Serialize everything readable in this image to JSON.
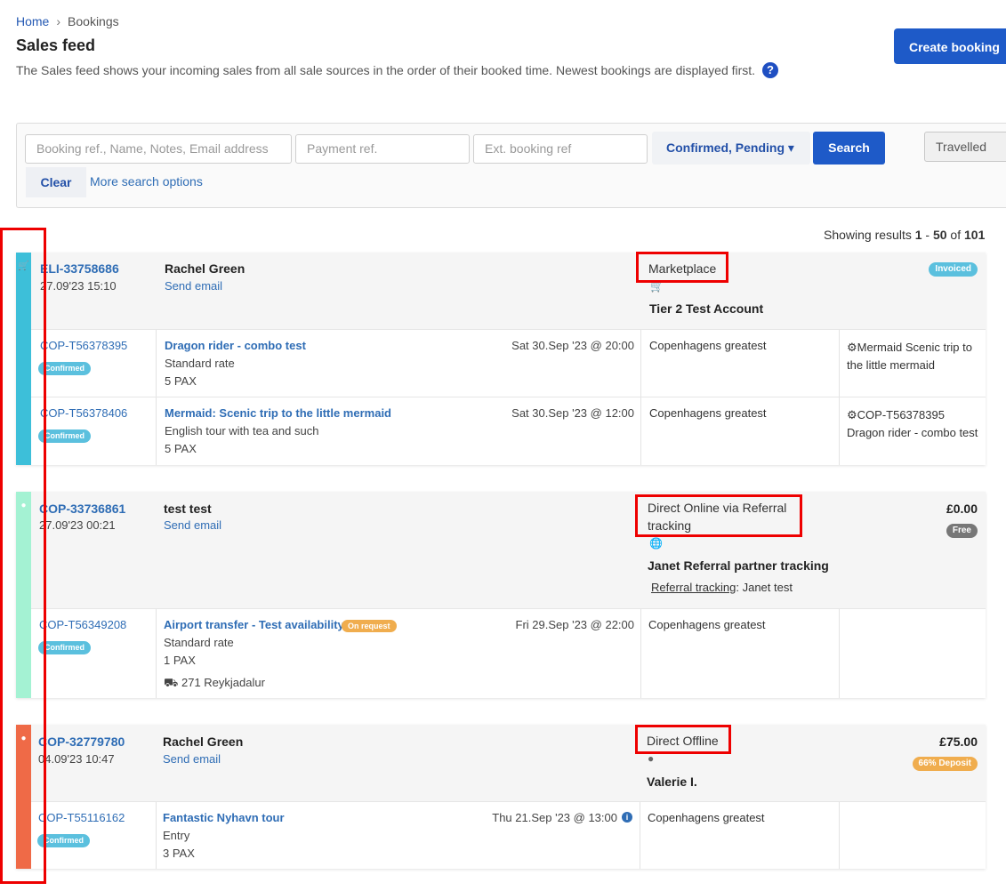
{
  "breadcrumb": {
    "home": "Home",
    "separator": "›",
    "current": "Bookings"
  },
  "page": {
    "title": "Sales feed",
    "description": "The Sales feed shows your incoming sales from all sale sources in the order of their booked time. Newest bookings are displayed first.",
    "help_icon": "?",
    "create_button": "Create booking"
  },
  "search": {
    "booking_placeholder": "Booking ref., Name, Notes, Email address",
    "payment_placeholder": "Payment ref.",
    "ext_placeholder": "Ext. booking ref",
    "status_filter": "Confirmed, Pending ▾",
    "search_button": "Search",
    "travelled_toggle": "Travelled",
    "clear_button": "Clear",
    "more_options": "More search options"
  },
  "results": {
    "prefix": "Showing results ",
    "from": "1",
    "dash": " - ",
    "to": "50",
    "of": " of ",
    "total": "101"
  },
  "icons": {
    "cart": "cart-icon",
    "globe": "globe-icon",
    "user": "user-icon",
    "truck": "truck-icon",
    "puzzle": "puzzle-icon",
    "info": "info-icon"
  },
  "colors": {
    "accent": "#1e5ac8",
    "marketplace": "#3dbfd9",
    "online": "#a4f2d3",
    "offline": "#ef6a47",
    "confirmed": "#5bc0de",
    "invoiced": "#5bc0de",
    "free": "#777777",
    "deposit": "#f0ad4e",
    "on_request": "#f0ad4e",
    "highlight": "#ee0000"
  },
  "bookings": [
    {
      "ref": "ELI-33758686",
      "datetime": "27.09'23 15:10",
      "customer": "Rachel Green",
      "send_email": "Send email",
      "source": "Marketplace",
      "account": "Tier 2 Test Account",
      "amount": "",
      "badge": "Invoiced",
      "items": [
        {
          "ref": "COP-T56378395",
          "status": "Confirmed",
          "product": "Dragon rider - combo test",
          "rate": "Standard rate",
          "pax": "5 PAX",
          "when": "Sat 30.Sep '23 @ 20:00",
          "supplier": "Copenhagens greatest",
          "linked_line1": "Mermaid Scenic trip to",
          "linked_line2": "the little mermaid"
        },
        {
          "ref": "COP-T56378406",
          "status": "Confirmed",
          "product": "Mermaid: Scenic trip to the little mermaid",
          "rate": "English tour with tea and such",
          "pax": "5 PAX",
          "when": "Sat 30.Sep '23 @ 12:00",
          "supplier": "Copenhagens greatest",
          "linked_line1": "COP-T56378395",
          "linked_line2": "Dragon rider - combo test"
        }
      ]
    },
    {
      "ref": "COP-33736861",
      "datetime": "27.09'23 00:21",
      "customer": "test test",
      "send_email": "Send email",
      "source_line1": "Direct Online via Referral",
      "source_line2": "tracking",
      "account": "Janet Referral partner tracking",
      "referral_label": "Referral tracking",
      "referral_value": ": Janet test",
      "amount": "£0.00",
      "badge": "Free",
      "items": [
        {
          "ref": "COP-T56349208",
          "status": "Confirmed",
          "product": "Airport transfer - Test availability",
          "tag": "On request",
          "rate": "Standard rate",
          "pax": "1 PAX",
          "pickup": "271 Reykjadalur",
          "when": "Fri 29.Sep '23 @ 22:00",
          "supplier": "Copenhagens greatest"
        }
      ]
    },
    {
      "ref": "COP-32779780",
      "datetime": "04.09'23 10:47",
      "customer": "Rachel Green",
      "send_email": "Send email",
      "source": "Direct Offline",
      "account": "Valerie I.",
      "amount": "£75.00",
      "badge": "66% Deposit",
      "items": [
        {
          "ref": "COP-T55116162",
          "status": "Confirmed",
          "product": "Fantastic Nyhavn tour",
          "rate": "Entry",
          "pax": "3 PAX",
          "when": "Thu 21.Sep '23 @ 13:00",
          "supplier": "Copenhagens greatest"
        }
      ]
    }
  ]
}
